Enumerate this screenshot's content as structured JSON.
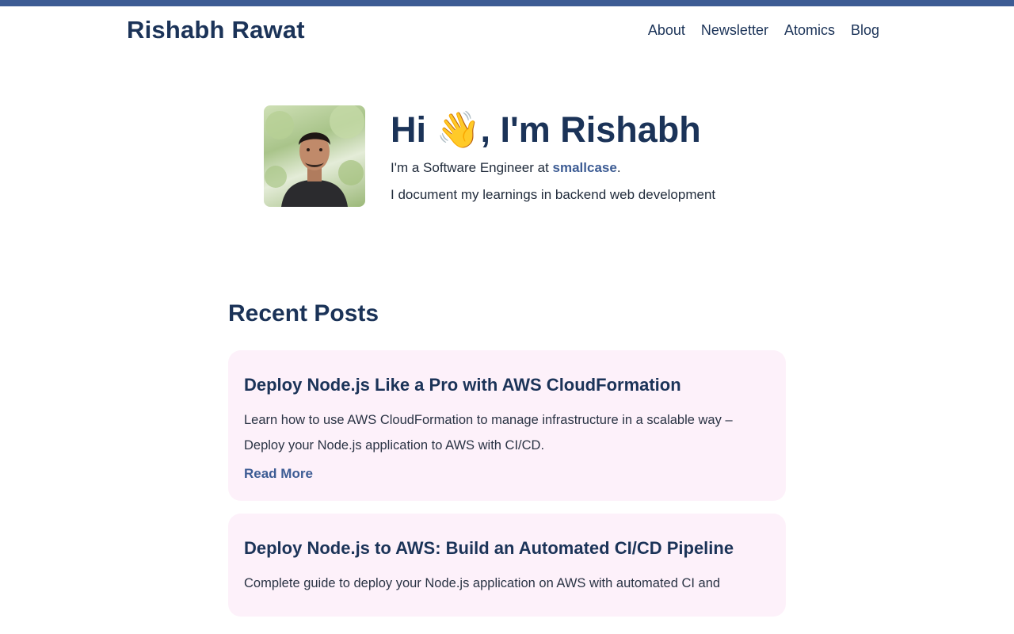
{
  "site": {
    "title": "Rishabh Rawat"
  },
  "nav": {
    "items": [
      "About",
      "Newsletter",
      "Atomics",
      "Blog"
    ]
  },
  "hero": {
    "greeting": "Hi 👋, I'm Rishabh",
    "intro_prefix": "I'm a Software Engineer at ",
    "company": "smallcase",
    "intro_suffix": ".",
    "tagline": "I document my learnings in backend web development"
  },
  "recent_posts": {
    "heading": "Recent Posts",
    "posts": [
      {
        "title": "Deploy Node.js Like a Pro with AWS CloudFormation",
        "description": "Learn how to use AWS CloudFormation to manage infrastructure in a scalable way – Deploy your Node.js application to AWS with CI/CD.",
        "link_label": "Read More"
      },
      {
        "title": "Deploy Node.js to AWS: Build an Automated CI/CD Pipeline",
        "description": "Complete guide to deploy your Node.js application on AWS with automated CI and"
      }
    ]
  },
  "colors": {
    "accent": "#3d5c94",
    "heading": "#1b3358",
    "card_background": "#fdf1fa"
  }
}
